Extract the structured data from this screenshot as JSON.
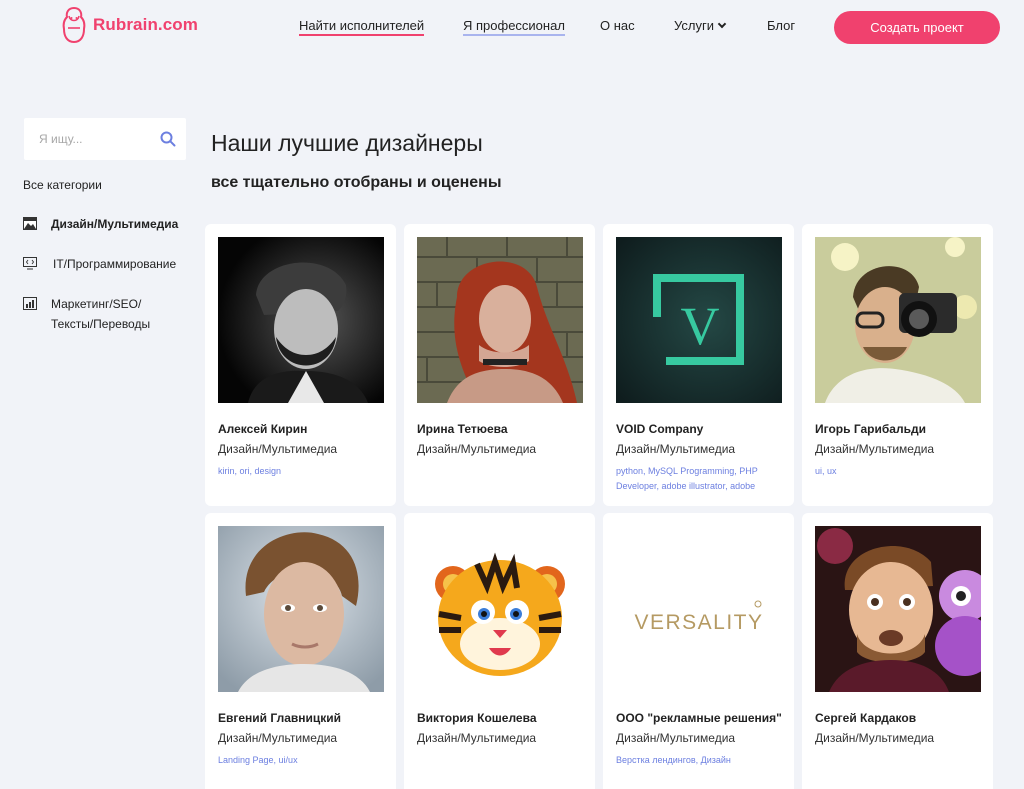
{
  "header": {
    "logo_text": "Rubrain.com",
    "nav": [
      {
        "label": "Найти исполнителей"
      },
      {
        "label": "Я профессионал"
      },
      {
        "label": "О нас"
      },
      {
        "label": "Услуги"
      },
      {
        "label": "Блог"
      }
    ],
    "cta_label": "Создать проект"
  },
  "sidebar": {
    "search_placeholder": "Я ищу...",
    "all_categories": "Все категории",
    "categories": [
      {
        "label": "Дизайн/Мультимедиа",
        "icon": "image-icon",
        "active": true
      },
      {
        "label": "IT/Программирование",
        "icon": "code-monitor-icon",
        "active": false
      },
      {
        "label_line1": "Маркетинг/SEO/",
        "label_line2": "Тексты/Переводы",
        "icon": "chart-icon",
        "active": false
      }
    ]
  },
  "main": {
    "title": "Наши лучшие дизайнеры",
    "subtitle": "все тщательно отобраны и оценены",
    "cards": [
      {
        "name": "Алексей Кирин",
        "category": "Дизайн/Мультимедиа",
        "tags": "kirin, ori, design"
      },
      {
        "name": "Ирина Тетюева",
        "category": "Дизайн/Мультимедиа",
        "tags": ""
      },
      {
        "name": "VOID Company",
        "category": "Дизайн/Мультимедиа",
        "tags": "python, MySQL Programming, PHP Developer, adobe illustrator, adobe",
        "logo_letter": "V"
      },
      {
        "name": "Игорь Гарибальди",
        "category": "Дизайн/Мультимедиа",
        "tags": "ui, ux"
      },
      {
        "name": "Евгений Главницкий",
        "category": "Дизайн/Мультимедиа",
        "tags": "Landing Page, ui/ux"
      },
      {
        "name": "Виктория Кошелева",
        "category": "Дизайн/Мультимедиа",
        "tags": ""
      },
      {
        "name": "ООО \"рекламные решения\"",
        "category": "Дизайн/Мультимедиа",
        "tags": "Верстка лендингов, Дизайн",
        "logo_text": "VERSALITY"
      },
      {
        "name": "Сергей Кардаков",
        "category": "Дизайн/Мультимедиа",
        "tags": ""
      }
    ]
  },
  "colors": {
    "accent": "#f0416e",
    "tag": "#6c7fe0",
    "background": "#f1f3f8"
  }
}
